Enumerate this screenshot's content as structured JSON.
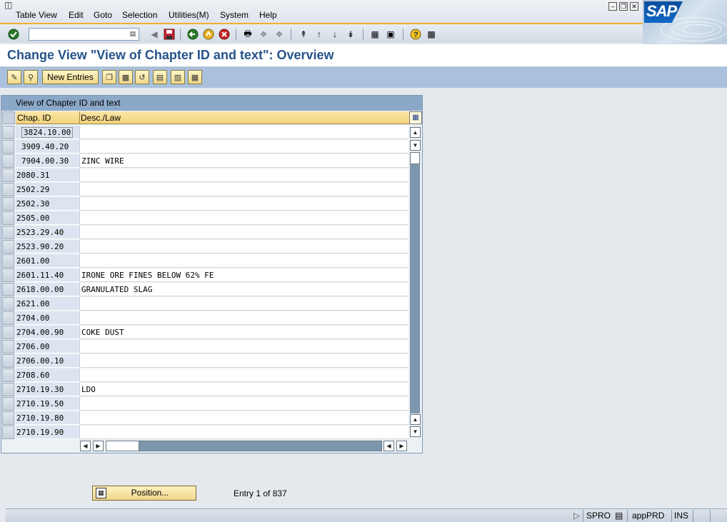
{
  "menubar": {
    "items": [
      "Table View",
      "Edit",
      "Goto",
      "Selection",
      "Utilities(M)",
      "System",
      "Help"
    ]
  },
  "logo": {
    "text": "SAP"
  },
  "toolbar": {
    "command_value": "",
    "icons": [
      "enter-icon",
      "back-arrow-icon",
      "save-icon",
      "back-icon",
      "exit-icon",
      "cancel-icon",
      "print-icon",
      "find-icon",
      "find-next-icon",
      "first-page-icon",
      "previous-page-icon",
      "next-page-icon",
      "last-page-icon",
      "create-session-icon",
      "shortcut-icon",
      "help-icon",
      "customize-layout-icon"
    ]
  },
  "title": "Change View \"View of Chapter ID and text\": Overview",
  "app_toolbar": {
    "new_entries_label": "New Entries"
  },
  "table": {
    "caption": "View of Chapter ID and text",
    "columns": [
      "Chap. ID",
      "Desc./Law"
    ],
    "rows": [
      {
        "id": "3824.10.00",
        "desc": "",
        "indent": true,
        "focused": true
      },
      {
        "id": "3909.40.20",
        "desc": "",
        "indent": true
      },
      {
        "id": "7904.00.30",
        "desc": "ZINC WIRE",
        "indent": true
      },
      {
        "id": "2080.31",
        "desc": ""
      },
      {
        "id": "2502.29",
        "desc": ""
      },
      {
        "id": "2502.30",
        "desc": ""
      },
      {
        "id": "2505.00",
        "desc": ""
      },
      {
        "id": "2523.29.40",
        "desc": ""
      },
      {
        "id": "2523.90.20",
        "desc": ""
      },
      {
        "id": "2601.00",
        "desc": ""
      },
      {
        "id": "2601.11.40",
        "desc": "IRONE ORE FINES BELOW 62% FE"
      },
      {
        "id": "2618.00.00",
        "desc": "GRANULATED SLAG"
      },
      {
        "id": "2621.00",
        "desc": ""
      },
      {
        "id": "2704.00",
        "desc": ""
      },
      {
        "id": "2704.00.90",
        "desc": "COKE DUST"
      },
      {
        "id": "2706.00",
        "desc": ""
      },
      {
        "id": "2706.00.10",
        "desc": ""
      },
      {
        "id": "2708.60",
        "desc": ""
      },
      {
        "id": "2710.19.30",
        "desc": "LDO"
      },
      {
        "id": "2710.19.50",
        "desc": ""
      },
      {
        "id": "2710.19.80",
        "desc": ""
      },
      {
        "id": "2710.19.90",
        "desc": ""
      }
    ]
  },
  "position": {
    "button_label": "Position...",
    "entry_info": "Entry 1 of 837"
  },
  "statusbar": {
    "transaction": "SPRO",
    "server": "appPRD",
    "mode": "INS"
  },
  "colors": {
    "title": "#26538a",
    "app_toolbar": "#a9c1dc",
    "table_caption": "#8ba8c8",
    "column_header": "#f2d27a"
  }
}
